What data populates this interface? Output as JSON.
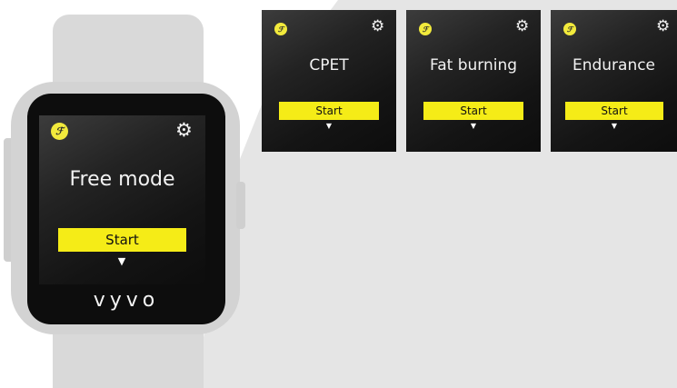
{
  "watch": {
    "brand": "vyvo",
    "screen": {
      "badge_glyph": "ℱ",
      "gear_glyph": "⚙",
      "title": "Free mode",
      "start_label": "Start",
      "arrow_glyph": "▼"
    }
  },
  "modes": [
    {
      "title": "CPET",
      "start_label": "Start",
      "badge_glyph": "ℱ",
      "gear_glyph": "⚙",
      "arrow_glyph": "▼"
    },
    {
      "title": "Fat burning",
      "start_label": "Start",
      "badge_glyph": "ℱ",
      "gear_glyph": "⚙",
      "arrow_glyph": "▼"
    },
    {
      "title": "Endurance",
      "start_label": "Start",
      "badge_glyph": "ℱ",
      "gear_glyph": "⚙",
      "arrow_glyph": "▼"
    }
  ],
  "icons": {
    "badge": "function-badge-icon",
    "settings": "gear-icon",
    "more": "chevron-down-icon"
  },
  "colors": {
    "accent_yellow": "#f5ec17",
    "badge_yellow": "#f2ea3c",
    "screen_dark": "#141414",
    "bezel": "#0d0d0d",
    "watch_body": "#d3d3d3",
    "background_panel": "#e5e5e5"
  }
}
